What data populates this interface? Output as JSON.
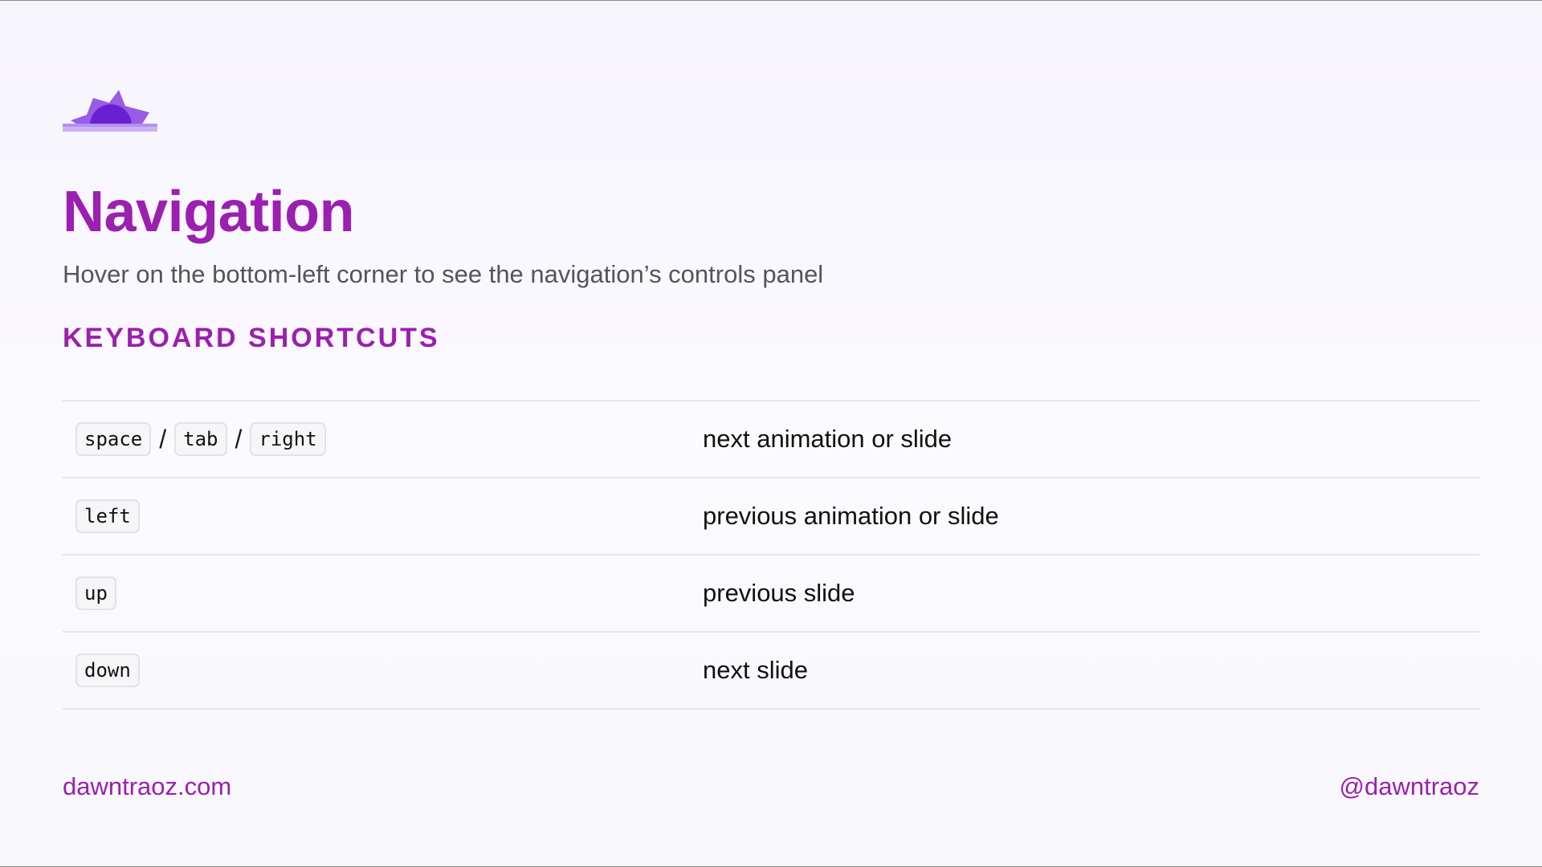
{
  "colors": {
    "accent": "#9b1fb0",
    "subtitle": "#54545c",
    "divider": "#e6e4ea",
    "logo_light": "#c9b3f2",
    "logo_mid": "#9a5be6",
    "logo_dark": "#6a1fd0"
  },
  "logo": {
    "icon": "sunrise-logo-icon"
  },
  "page": {
    "title": "Navigation",
    "subtitle": "Hover on the bottom-left corner to see the navigation’s controls panel",
    "section_heading": "KEYBOARD SHORTCUTS"
  },
  "shortcuts": [
    {
      "keys": [
        "space",
        "tab",
        "right"
      ],
      "separator": "/",
      "description": "next animation or slide"
    },
    {
      "keys": [
        "left"
      ],
      "description": "previous animation or slide"
    },
    {
      "keys": [
        "up"
      ],
      "description": "previous slide"
    },
    {
      "keys": [
        "down"
      ],
      "description": "next slide"
    }
  ],
  "footer": {
    "website": "dawntraoz.com",
    "handle": "@dawntraoz"
  }
}
